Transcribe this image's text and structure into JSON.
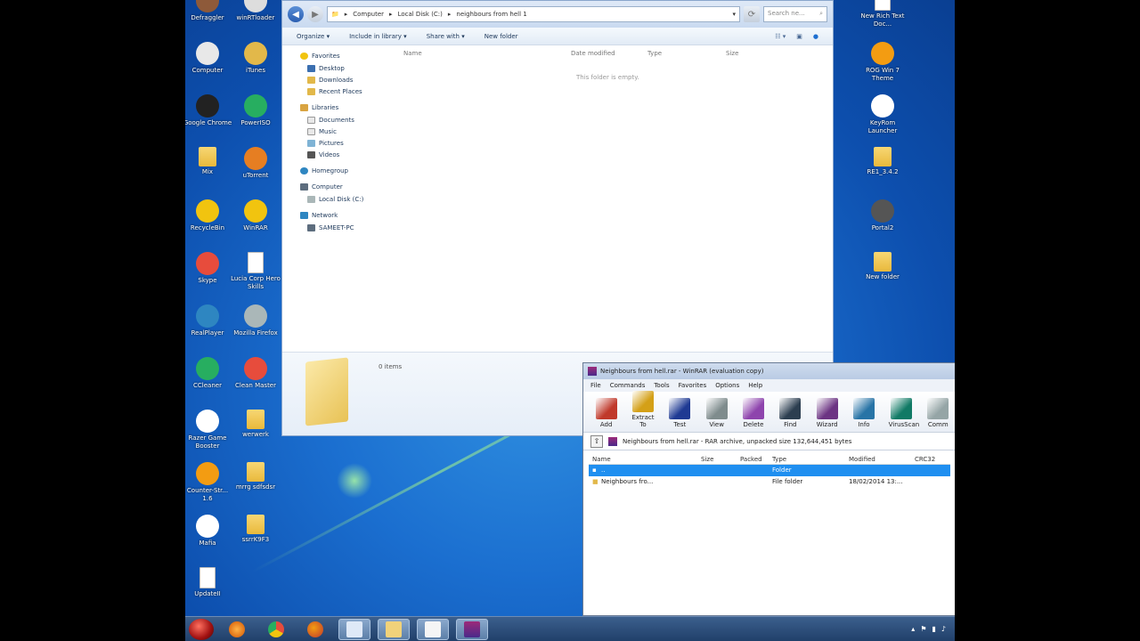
{
  "desktop": {
    "icons_left": [
      {
        "label": "Defraggler",
        "name": "defraggler"
      },
      {
        "label": "Computer",
        "name": "computer"
      },
      {
        "label": "Google Chrome",
        "name": "google-chrome"
      },
      {
        "label": "Mix",
        "name": "mix-folder"
      },
      {
        "label": "RecycleBin",
        "name": "recycle-bin"
      },
      {
        "label": "Skype",
        "name": "skype"
      },
      {
        "label": "RealPlayer",
        "name": "realplayer"
      },
      {
        "label": "CCleaner",
        "name": "ccleaner"
      },
      {
        "label": "Razer Game Booster",
        "name": "game-booster"
      },
      {
        "label": "Counter-Str... 1.6",
        "name": "counter-strike"
      },
      {
        "label": "Mafia",
        "name": "mafia"
      },
      {
        "label": "UpdateII",
        "name": "update-doc"
      }
    ],
    "icons_mid": [
      {
        "label": "winRTloader",
        "name": "winrtloader"
      },
      {
        "label": "iTunes",
        "name": "itunes"
      },
      {
        "label": "PowerISO",
        "name": "poweriso"
      },
      {
        "label": "uTorrent",
        "name": "utorrent"
      },
      {
        "label": "WinRAR",
        "name": "winrar"
      },
      {
        "label": "Lucia Corp Hero Skills",
        "name": "lucia-doc"
      },
      {
        "label": "Mozilla Firefox",
        "name": "firefox"
      },
      {
        "label": "Clean Master",
        "name": "clean-master"
      },
      {
        "label": "werwerk",
        "name": "werwerk-folder"
      },
      {
        "label": "mrrg sdfsdsr",
        "name": "mrrg-folder"
      },
      {
        "label": "ssrrK9F3",
        "name": "ssrr-folder"
      }
    ],
    "icons_right": [
      {
        "label": "New Rich Text Doc...",
        "name": "rtf-doc"
      },
      {
        "label": "ROG Win 7 Theme",
        "name": "rog-theme"
      },
      {
        "label": "KeyRom Launcher",
        "name": "keyrom-launcher"
      },
      {
        "label": "RE1_3.4.2",
        "name": "re1-folder"
      },
      {
        "label": "Portal2",
        "name": "portal2"
      },
      {
        "label": "New folder",
        "name": "new-folder"
      }
    ]
  },
  "explorer": {
    "breadcrumb": [
      "Computer",
      "Local Disk (C:)",
      "neighbours from hell 1"
    ],
    "search_placeholder": "Search ne...",
    "toolbar": {
      "organize": "Organize ▾",
      "include": "Include in library ▾",
      "share": "Share with ▾",
      "new_folder": "New folder"
    },
    "nav": {
      "favorites": {
        "title": "Favorites",
        "items": [
          "Desktop",
          "Downloads",
          "Recent Places"
        ]
      },
      "libraries": {
        "title": "Libraries",
        "items": [
          "Documents",
          "Music",
          "Pictures",
          "Videos"
        ]
      },
      "homegroup": "Homegroup",
      "computer": {
        "title": "Computer",
        "items": [
          "Local Disk (C:)"
        ]
      },
      "network": {
        "title": "Network",
        "items": [
          "SAMEET-PC"
        ]
      }
    },
    "columns": {
      "name": "Name",
      "date": "Date modified",
      "type": "Type",
      "size": "Size"
    },
    "empty_message": "This folder is empty.",
    "item_count": "0 items"
  },
  "winrar": {
    "title": "Neighbours from hell.rar - WinRAR (evaluation copy)",
    "menu": [
      "File",
      "Commands",
      "Tools",
      "Favorites",
      "Options",
      "Help"
    ],
    "tools": [
      {
        "label": "Add",
        "color": "#c0392b"
      },
      {
        "label": "Extract To",
        "color": "#d4a017"
      },
      {
        "label": "Test",
        "color": "#1f3a93"
      },
      {
        "label": "View",
        "color": "#7f8c8d"
      },
      {
        "label": "Delete",
        "color": "#8e44ad"
      },
      {
        "label": "Find",
        "color": "#2c3e50"
      },
      {
        "label": "Wizard",
        "color": "#6c3483"
      },
      {
        "label": "Info",
        "color": "#2874a6"
      },
      {
        "label": "VirusScan",
        "color": "#117a65"
      },
      {
        "label": "Comm",
        "color": "#95a5a6"
      }
    ],
    "path": "Neighbours from hell.rar - RAR archive, unpacked size 132,644,451 bytes",
    "columns": {
      "name": "Name",
      "size": "Size",
      "packed": "Packed",
      "type": "Type",
      "modified": "Modified",
      "crc": "CRC32"
    },
    "rows": [
      {
        "name": "..",
        "size": "",
        "packed": "",
        "type": "Folder",
        "modified": "",
        "crc": ""
      },
      {
        "name": "Neighbours fro...",
        "size": "",
        "packed": "",
        "type": "File folder",
        "modified": "18/02/2014 13:...",
        "crc": ""
      }
    ]
  },
  "colors": {
    "selection": "#1f8ff0",
    "desktop": "#1b6fd0"
  }
}
